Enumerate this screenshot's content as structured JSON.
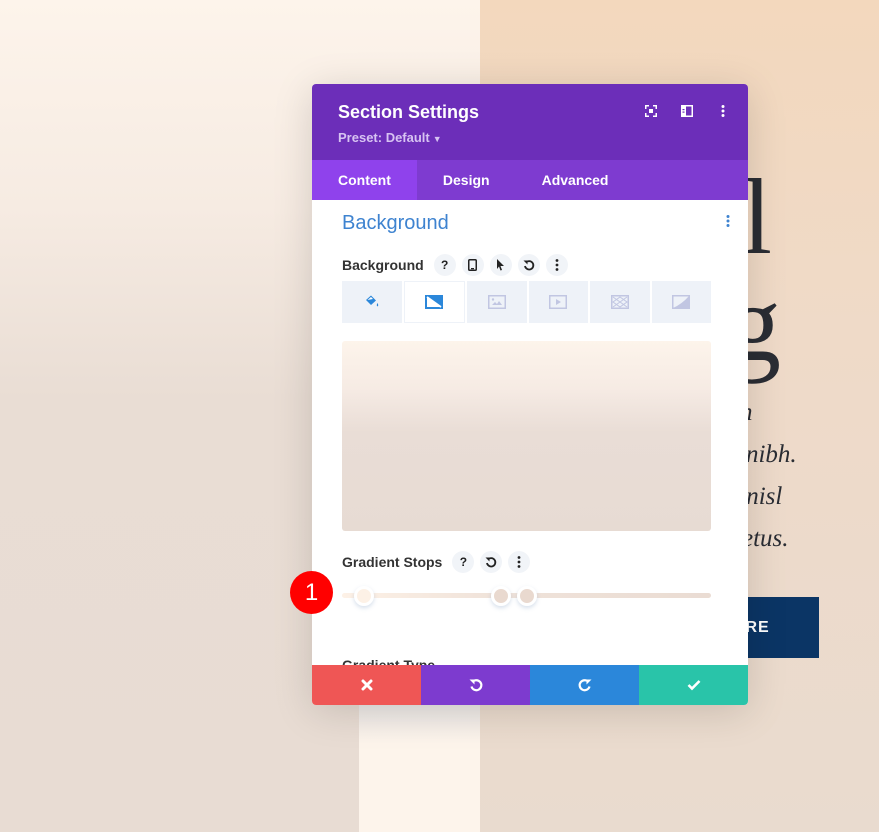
{
  "page": {
    "hero_letters": [
      "l",
      "g"
    ],
    "hero_lines": [
      "n",
      "s nibh.",
      "t nisl",
      "etus."
    ],
    "cta_label": "ORE"
  },
  "modal": {
    "title": "Section Settings",
    "preset": "Preset: Default",
    "header_icons": [
      "focus-icon",
      "sidebar-layout-icon",
      "more-vertical-icon"
    ],
    "tabs": [
      {
        "label": "Content",
        "active": true
      },
      {
        "label": "Design",
        "active": false
      },
      {
        "label": "Advanced",
        "active": false
      }
    ],
    "section_title": "Background",
    "background_field": {
      "label": "Background",
      "icons": [
        "help-icon",
        "mobile-icon",
        "cursor-icon",
        "reset-icon",
        "more-vertical-icon"
      ],
      "types": [
        {
          "name": "color",
          "active": false
        },
        {
          "name": "gradient",
          "active": true
        },
        {
          "name": "image",
          "active": false
        },
        {
          "name": "video",
          "active": false
        },
        {
          "name": "pattern",
          "active": false
        },
        {
          "name": "mask",
          "active": false
        }
      ]
    },
    "gradient_stops": {
      "label": "Gradient Stops",
      "icons": [
        "help-icon",
        "reset-icon",
        "more-vertical-icon"
      ],
      "stops": [
        {
          "position_pct": 6,
          "color": "#fdf1e6"
        },
        {
          "position_pct": 43,
          "color": "#e9d9cf"
        },
        {
          "position_pct": 50,
          "color": "#e9d9cf"
        }
      ]
    },
    "next_label": "Gradient Type",
    "footer": {
      "cancel": "✖",
      "undo": "↶",
      "redo": "↷",
      "save": "✔"
    }
  },
  "annotation_badge": "1",
  "colors": {
    "header": "#6c2eb9",
    "tabs": "#7e3bd0",
    "tab_active": "#8f42ec",
    "accent_blue": "#3e83d0",
    "cancel": "#ef5655",
    "undo": "#7d3bcf",
    "redo": "#2b87da",
    "save": "#29c4a9"
  }
}
